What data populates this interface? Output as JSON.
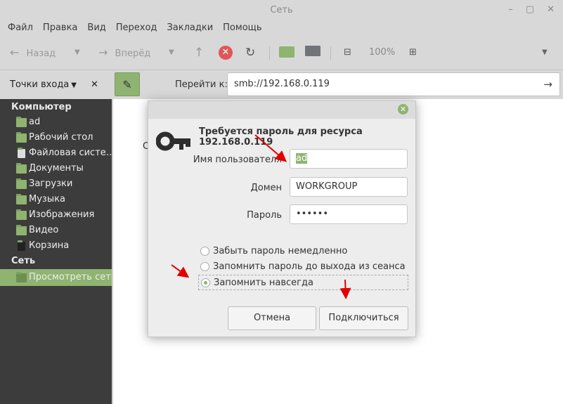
{
  "window": {
    "title": "Сеть"
  },
  "menu": [
    "Файл",
    "Правка",
    "Вид",
    "Переход",
    "Закладки",
    "Помощь"
  ],
  "toolbar": {
    "back": "Назад",
    "forward": "Вперёд",
    "zoom": "100%"
  },
  "places": {
    "label": "Точки входа"
  },
  "location": {
    "label": "Перейти к:",
    "value": "smb://192.168.0.119"
  },
  "sidebar": {
    "computer_header": "Компьютер",
    "computer_items": [
      "ad",
      "Рабочий стол",
      "Файловая систе…",
      "Документы",
      "Загрузки",
      "Музыка",
      "Изображения",
      "Видео",
      "Корзина"
    ],
    "network_header": "Сеть",
    "network_items": [
      "Просмотреть сеть"
    ]
  },
  "content": {
    "partial_text": "С"
  },
  "dialog": {
    "heading": "Требуется пароль для ресурса 192.168.0.119",
    "username_label": "Имя пользователя",
    "username_value": "ad",
    "domain_label": "Домен",
    "domain_value": "WORKGROUP",
    "password_label": "Пароль",
    "password_value": "••••••",
    "options": [
      "Забыть пароль немедленно",
      "Запомнить пароль до выхода из сеанса",
      "Запомнить навсегда"
    ],
    "selected_option": 2,
    "cancel": "Отмена",
    "connect": "Подключиться"
  },
  "colors": {
    "accent": "#8fb370",
    "sidebar": "#3c3c3c",
    "annotation": "#e00000"
  }
}
